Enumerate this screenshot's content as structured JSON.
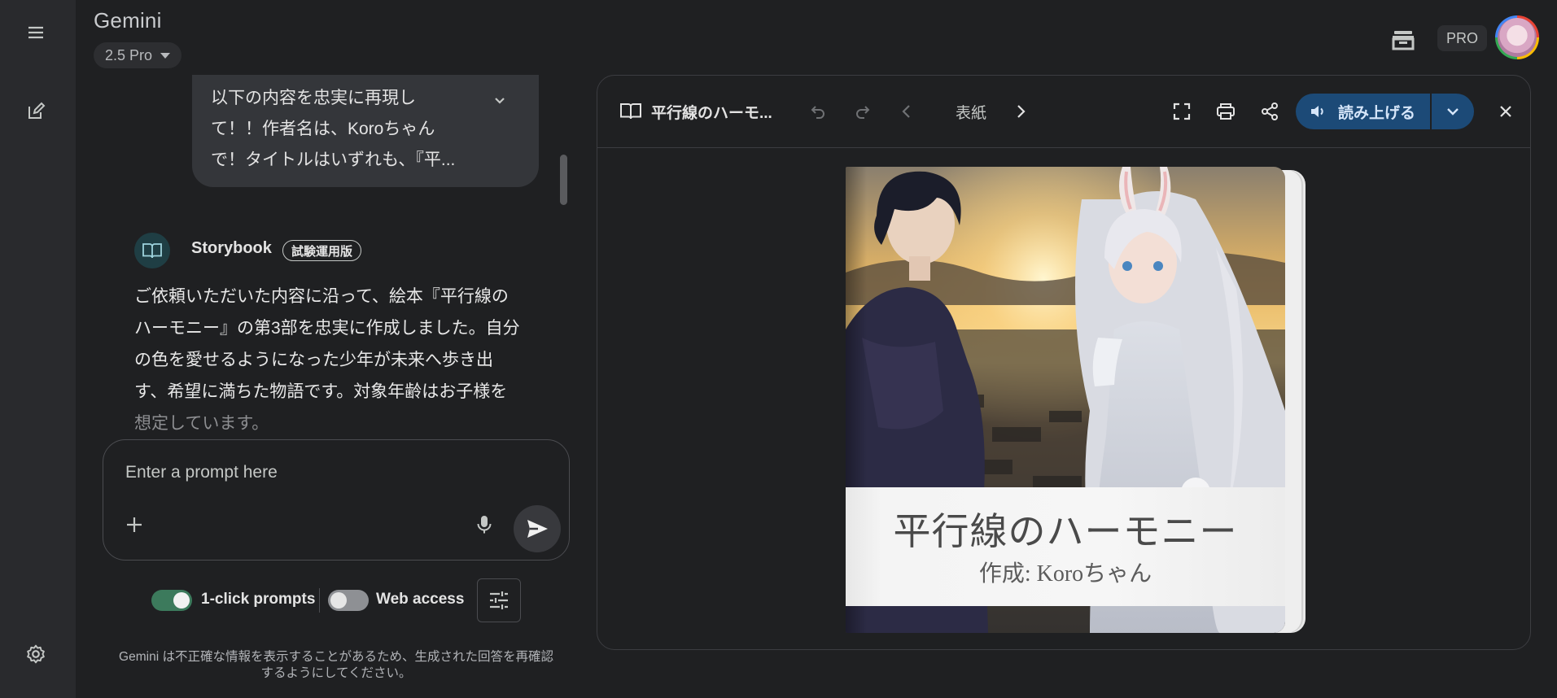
{
  "app": {
    "title": "Gemini",
    "model": "2.5 Pro",
    "plan_badge": "PRO"
  },
  "chat": {
    "user_message": {
      "lines": [
        "以下の内容を忠実に再現し",
        "て！！作者名は、Koroちゃん",
        "で！タイトルはいずれも、『平..."
      ]
    },
    "bot": {
      "name": "Storybook",
      "badge": "試験運用版",
      "lines": [
        "ご依頼いただいた内容に沿って、絵本『平行線の",
        "ハーモニー』の第3部を忠実に作成しました。自分",
        "の色を愛せるようになった少年が未来へ歩き出",
        "す、希望に満ちた物語です。対象年齢はお子様を",
        "想定しています。"
      ]
    }
  },
  "prompt": {
    "placeholder": "Enter a prompt here"
  },
  "options": {
    "one_click_label": "1-click prompts",
    "one_click_on": true,
    "web_access_label": "Web access",
    "web_access_on": false
  },
  "disclaimer": {
    "line1": "Gemini は不正確な情報を表示することがあるため、生成された回答を再確認",
    "line2": "するようにしてください。"
  },
  "storybook": {
    "title": "平行線のハーモ...",
    "page_label": "表紙",
    "read_aloud": "読み上げる",
    "cover": {
      "title": "平行線のハーモニー",
      "author": "作成: Koroちゃん"
    }
  },
  "colors": {
    "accent_toggle": "#3c7a5c",
    "read_button": "#1c4a77",
    "background": "#1f2022"
  }
}
